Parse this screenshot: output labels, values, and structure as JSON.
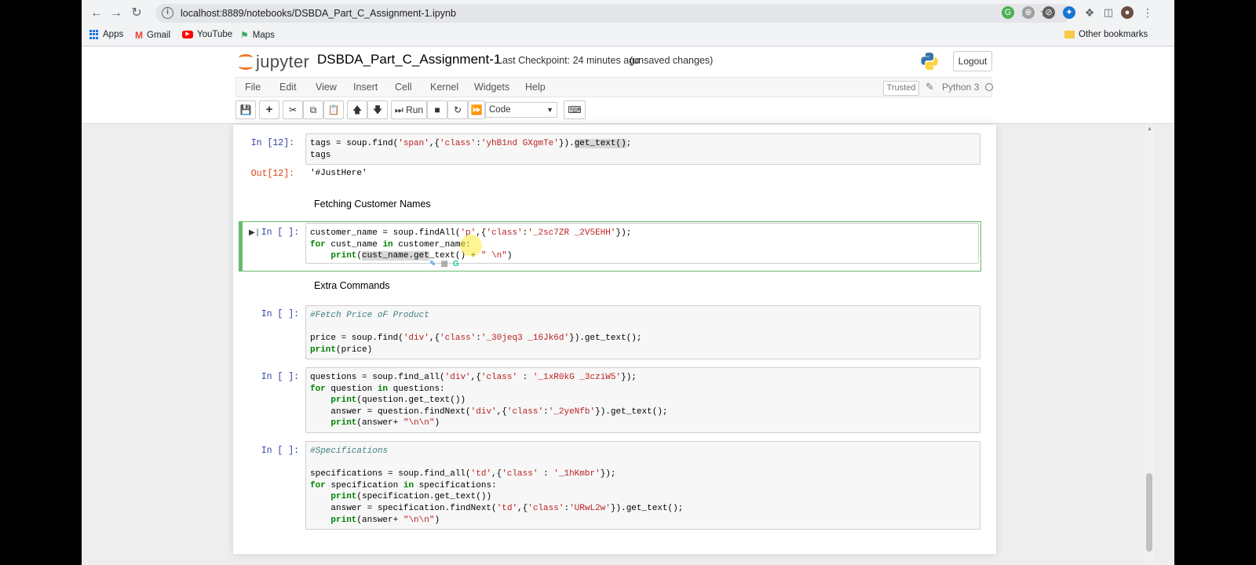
{
  "browser": {
    "url": "localhost:8889/notebooks/DSBDA_Part_C_Assignment-1.ipynb",
    "bookmarks": [
      "Apps",
      "Gmail",
      "YouTube",
      "Maps"
    ],
    "other_bookmarks": "Other bookmarks"
  },
  "jupyter": {
    "logo_text": "jupyter",
    "notebook_title": "DSBDA_Part_C_Assignment-1",
    "checkpoint": "Last Checkpoint: 24 minutes ago",
    "unsaved": "(unsaved changes)",
    "logout": "Logout",
    "menu": [
      "File",
      "Edit",
      "View",
      "Insert",
      "Cell",
      "Kernel",
      "Widgets",
      "Help"
    ],
    "trusted": "Trusted",
    "kernel_name": "Python 3",
    "run_label": "Run",
    "cell_type": "Code"
  },
  "cells": {
    "c1_prompt": "In [12]:",
    "c1_out_prompt": "Out[12]:",
    "c1_output": "'#JustHere'",
    "md1": "Fetching Customer Names",
    "c2_prompt": "In [ ]:",
    "md2": "Extra Commands",
    "c3_prompt": "In [ ]:",
    "c4_prompt": "In [ ]:",
    "c5_prompt": "In [ ]:"
  },
  "colors": {
    "in_prompt": "#303f9f",
    "out_prompt": "#d84315",
    "selected_border": "#66bb6a",
    "jupyter_orange": "#f37726"
  }
}
